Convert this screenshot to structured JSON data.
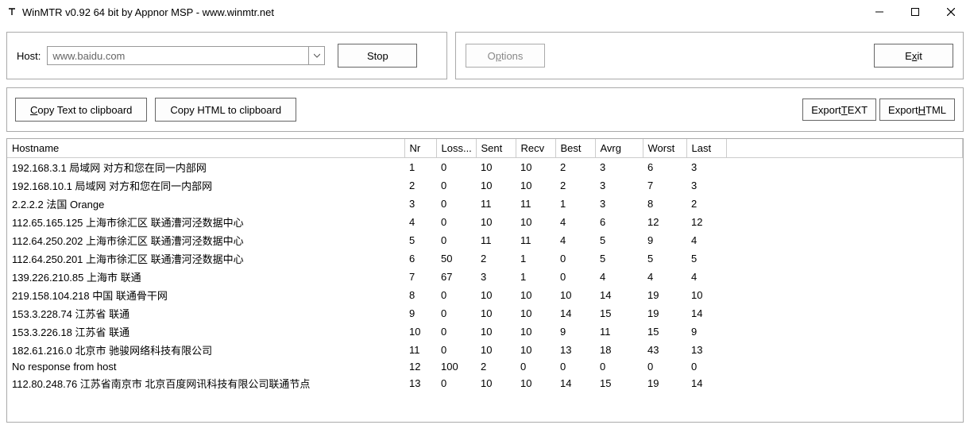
{
  "window": {
    "title": "WinMTR v0.92 64 bit by Appnor MSP - www.winmtr.net"
  },
  "host": {
    "label": "Host:",
    "value": "www.baidu.com"
  },
  "buttons": {
    "stop": "Stop",
    "options_pre": "O",
    "options_ul": "p",
    "options_post": "tions",
    "exit_pre": "E",
    "exit_ul": "x",
    "exit_post": "it",
    "copy_text_pre": "",
    "copy_text_ul": "C",
    "copy_text_post": "opy Text to clipboard",
    "copy_html": "Copy HTML to clipboard",
    "export_text_pre": "Export ",
    "export_text_ul": "T",
    "export_text_post": "EXT",
    "export_html_pre": "Export ",
    "export_html_ul": "H",
    "export_html_post": "TML"
  },
  "columns": [
    "Hostname",
    "Nr",
    "Loss...",
    "Sent",
    "Recv",
    "Best",
    "Avrg",
    "Worst",
    "Last"
  ],
  "rows": [
    {
      "host": "192.168.3.1 局域网 对方和您在同一内部网",
      "nr": 1,
      "loss": 0,
      "sent": 10,
      "recv": 10,
      "best": 2,
      "avrg": 3,
      "worst": 6,
      "last": 3
    },
    {
      "host": "192.168.10.1 局域网 对方和您在同一内部网",
      "nr": 2,
      "loss": 0,
      "sent": 10,
      "recv": 10,
      "best": 2,
      "avrg": 3,
      "worst": 7,
      "last": 3
    },
    {
      "host": "2.2.2.2 法国 Orange",
      "nr": 3,
      "loss": 0,
      "sent": 11,
      "recv": 11,
      "best": 1,
      "avrg": 3,
      "worst": 8,
      "last": 2
    },
    {
      "host": "112.65.165.125 上海市徐汇区 联通漕河泾数据中心",
      "nr": 4,
      "loss": 0,
      "sent": 10,
      "recv": 10,
      "best": 4,
      "avrg": 6,
      "worst": 12,
      "last": 12
    },
    {
      "host": "112.64.250.202 上海市徐汇区 联通漕河泾数据中心",
      "nr": 5,
      "loss": 0,
      "sent": 11,
      "recv": 11,
      "best": 4,
      "avrg": 5,
      "worst": 9,
      "last": 4
    },
    {
      "host": "112.64.250.201 上海市徐汇区 联通漕河泾数据中心",
      "nr": 6,
      "loss": 50,
      "sent": 2,
      "recv": 1,
      "best": 0,
      "avrg": 5,
      "worst": 5,
      "last": 5
    },
    {
      "host": "139.226.210.85 上海市 联通",
      "nr": 7,
      "loss": 67,
      "sent": 3,
      "recv": 1,
      "best": 0,
      "avrg": 4,
      "worst": 4,
      "last": 4
    },
    {
      "host": "219.158.104.218 中国 联通骨干网",
      "nr": 8,
      "loss": 0,
      "sent": 10,
      "recv": 10,
      "best": 10,
      "avrg": 14,
      "worst": 19,
      "last": 10
    },
    {
      "host": "153.3.228.74 江苏省 联通",
      "nr": 9,
      "loss": 0,
      "sent": 10,
      "recv": 10,
      "best": 14,
      "avrg": 15,
      "worst": 19,
      "last": 14
    },
    {
      "host": "153.3.226.18 江苏省 联通",
      "nr": 10,
      "loss": 0,
      "sent": 10,
      "recv": 10,
      "best": 9,
      "avrg": 11,
      "worst": 15,
      "last": 9
    },
    {
      "host": "182.61.216.0 北京市 驰骏网络科技有限公司",
      "nr": 11,
      "loss": 0,
      "sent": 10,
      "recv": 10,
      "best": 13,
      "avrg": 18,
      "worst": 43,
      "last": 13
    },
    {
      "host": "No response from host",
      "nr": 12,
      "loss": 100,
      "sent": 2,
      "recv": 0,
      "best": 0,
      "avrg": 0,
      "worst": 0,
      "last": 0
    },
    {
      "host": "112.80.248.76 江苏省南京市 北京百度网讯科技有限公司联通节点",
      "nr": 13,
      "loss": 0,
      "sent": 10,
      "recv": 10,
      "best": 14,
      "avrg": 15,
      "worst": 19,
      "last": 14
    }
  ]
}
